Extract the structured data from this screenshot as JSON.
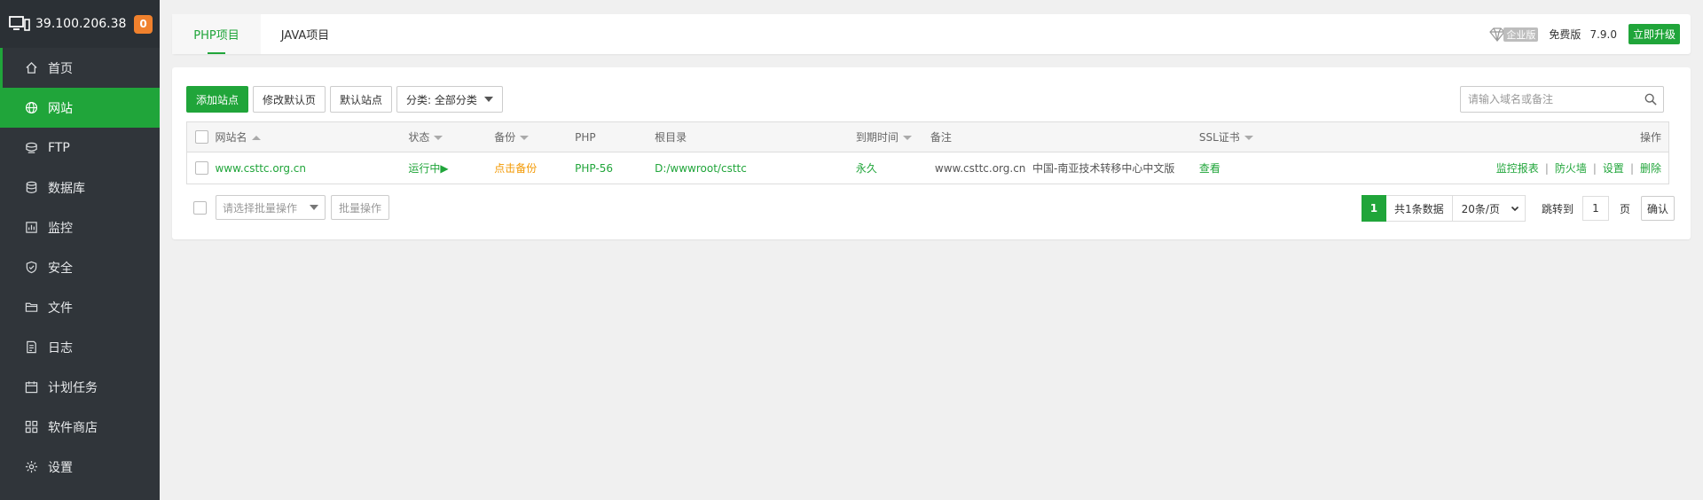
{
  "sidebar": {
    "server_ip": "39.100.206.38",
    "notice_count": "0",
    "items": [
      {
        "label": "首页",
        "icon": "home-icon"
      },
      {
        "label": "网站",
        "icon": "globe-icon"
      },
      {
        "label": "FTP",
        "icon": "ftp-icon"
      },
      {
        "label": "数据库",
        "icon": "database-icon"
      },
      {
        "label": "监控",
        "icon": "monitor-icon"
      },
      {
        "label": "安全",
        "icon": "shield-icon"
      },
      {
        "label": "文件",
        "icon": "folder-icon"
      },
      {
        "label": "日志",
        "icon": "log-icon"
      },
      {
        "label": "计划任务",
        "icon": "calendar-icon"
      },
      {
        "label": "软件商店",
        "icon": "grid-icon"
      },
      {
        "label": "设置",
        "icon": "gear-icon"
      }
    ]
  },
  "tabs": [
    {
      "label": "PHP项目"
    },
    {
      "label": "JAVA项目"
    }
  ],
  "top_right": {
    "enterprise": "企业版",
    "edition": "免费版",
    "version": "7.9.0",
    "upgrade": "立即升级"
  },
  "toolbar": {
    "add_site": "添加站点",
    "edit_default_page": "修改默认页",
    "default_site": "默认站点",
    "category": "分类: 全部分类"
  },
  "search": {
    "placeholder": "请输入域名或备注"
  },
  "table": {
    "headers": {
      "site_name": "网站名",
      "status": "状态",
      "backup": "备份",
      "php": "PHP",
      "root": "根目录",
      "expire": "到期时间",
      "note": "备注",
      "ssl": "SSL证书",
      "actions": "操作"
    },
    "rows": [
      {
        "site_name": "www.csttc.org.cn",
        "status": "运行中▶",
        "backup": "点击备份",
        "php": "PHP-56",
        "root": "D:/wwwroot/csttc",
        "expire": "永久",
        "note": "www.csttc.org.cn  中国-南亚技术转移中心中文版",
        "ssl": "查看",
        "actions": [
          "监控报表",
          "防火墙",
          "设置",
          "删除"
        ]
      }
    ]
  },
  "batch": {
    "select_placeholder": "请选择批量操作",
    "button": "批量操作"
  },
  "pager": {
    "current": "1",
    "total": "共1条数据",
    "page_size": "20条/页",
    "jump_to": "跳转到",
    "jump_value": "1",
    "page_unit": "页",
    "confirm": "确认"
  },
  "colors": {
    "accent": "#20a53a",
    "sidebar_bg": "#30353a",
    "badge": "#f0812d",
    "backup_link": "#f39800"
  }
}
